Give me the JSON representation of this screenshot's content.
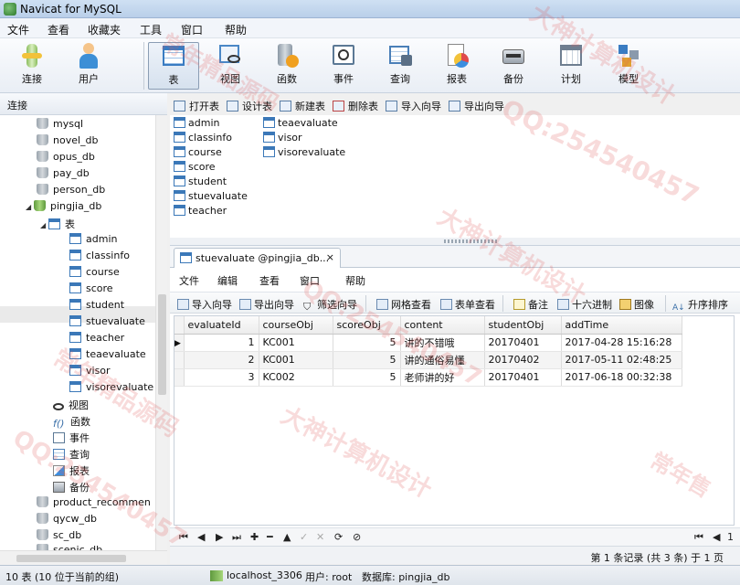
{
  "window": {
    "title": "Navicat for MySQL"
  },
  "menubar": [
    "文件",
    "查看",
    "收藏夹",
    "工具",
    "窗口",
    "帮助"
  ],
  "toolbar": [
    {
      "label": "连接",
      "icon": "connection-icon"
    },
    {
      "label": "用户",
      "icon": "user-icon"
    },
    {
      "label": "表",
      "icon": "table-icon"
    },
    {
      "label": "视图",
      "icon": "view-icon"
    },
    {
      "label": "函数",
      "icon": "function-icon"
    },
    {
      "label": "事件",
      "icon": "event-icon"
    },
    {
      "label": "查询",
      "icon": "query-icon"
    },
    {
      "label": "报表",
      "icon": "report-icon"
    },
    {
      "label": "备份",
      "icon": "backup-icon"
    },
    {
      "label": "计划",
      "icon": "schedule-icon"
    },
    {
      "label": "模型",
      "icon": "model-icon"
    }
  ],
  "left_panel": {
    "header": "连接",
    "databases_top": [
      "mysql",
      "novel_db",
      "opus_db",
      "pay_db",
      "person_db"
    ],
    "open_db": "pingjia_db",
    "tables_node": "表",
    "tables": [
      "admin",
      "classinfo",
      "course",
      "score",
      "student",
      "stuevaluate",
      "teacher",
      "teaevaluate",
      "visor",
      "visorevaluate"
    ],
    "selected_table": "stuevaluate",
    "other_nodes": [
      "视图",
      "函数",
      "事件",
      "查询",
      "报表",
      "备份"
    ],
    "databases_bottom": [
      "product_recommen",
      "qycw_db",
      "sc_db",
      "scenic_db"
    ]
  },
  "object_toolbar": [
    "打开表",
    "设计表",
    "新建表",
    "删除表",
    "导入向导",
    "导出向导"
  ],
  "object_list": {
    "col1": [
      "admin",
      "classinfo",
      "course",
      "score",
      "student",
      "stuevaluate",
      "teacher"
    ],
    "col2": [
      "teaevaluate",
      "visor",
      "visorevaluate"
    ]
  },
  "inner_window": {
    "tab": "stuevaluate @pingjia_db...",
    "tab_close": "×",
    "menu": [
      "文件",
      "编辑",
      "查看",
      "窗口",
      "帮助"
    ],
    "toolbar": [
      "导入向导",
      "导出向导",
      "筛选向导",
      "网格查看",
      "表单查看",
      "备注",
      "十六进制",
      "图像",
      "升序排序"
    ],
    "columns": [
      "evaluateId",
      "courseObj",
      "scoreObj",
      "content",
      "studentObj",
      "addTime"
    ],
    "rows": [
      [
        "1",
        "KC001",
        "5",
        "讲的不错哦",
        "20170401",
        "2017-04-28 15:16:28"
      ],
      [
        "2",
        "KC001",
        "5",
        "讲的通俗易懂",
        "20170402",
        "2017-05-11 02:48:25"
      ],
      [
        "3",
        "KC002",
        "5",
        "老师讲的好",
        "20170401",
        "2017-06-18 00:32:38"
      ]
    ],
    "nav_symbols": [
      "⏮",
      "◀",
      "▶",
      "⏭",
      "✚",
      "━",
      "▲",
      "✓",
      "✕",
      "⟳",
      "⊘"
    ],
    "page_right": "1",
    "record_info": "第 1 条记录 (共 3 条) 于 1 页"
  },
  "statusbar": {
    "left": "10 表 (10 位于当前的组)",
    "server": "localhost_3306",
    "user": "用户: root",
    "database": "数据库: pingjia_db"
  },
  "watermarks": [
    "大神计算机设计",
    "QQ:254540457",
    "常年精品源码",
    "大神计算机设计",
    "QQ:254540457",
    "常年精品源码",
    "大神计算机设计",
    "QQ:254540457",
    "常年售"
  ]
}
